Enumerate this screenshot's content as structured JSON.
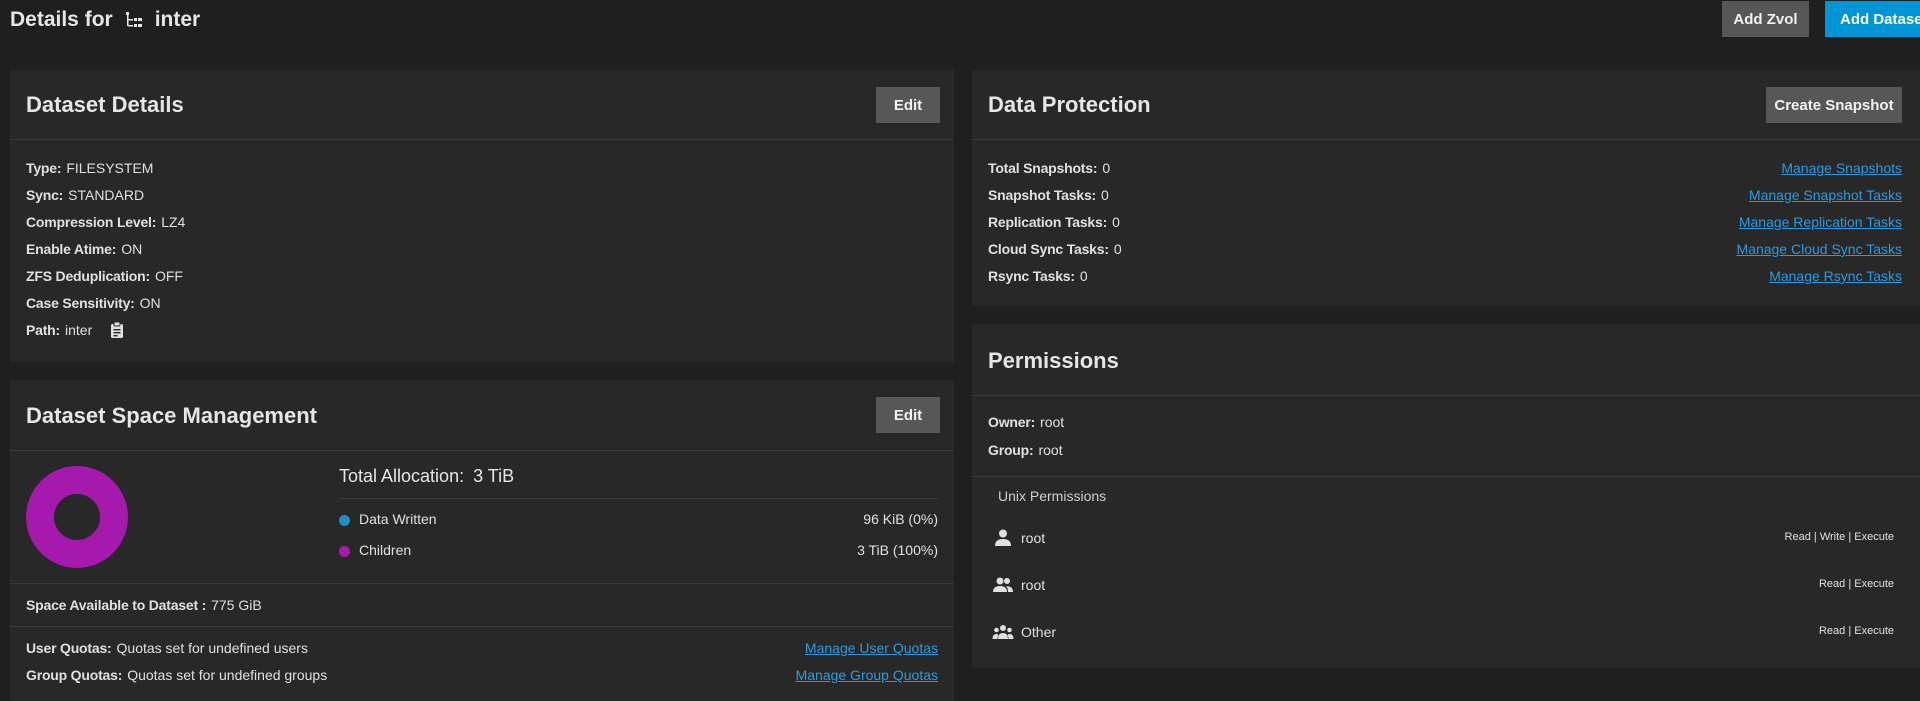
{
  "header": {
    "title_prefix": "Details for",
    "dataset_name": "inter",
    "add_zvol": "Add Zvol",
    "add_dataset": "Add Dataset"
  },
  "dataset_details": {
    "title": "Dataset Details",
    "edit": "Edit",
    "type_label": "Type:",
    "type": "FILESYSTEM",
    "sync_label": "Sync:",
    "sync": "STANDARD",
    "compression_label": "Compression Level:",
    "compression": "LZ4",
    "atime_label": "Enable Atime:",
    "atime": "ON",
    "dedup_label": "ZFS Deduplication:",
    "dedup": "OFF",
    "case_label": "Case Sensitivity:",
    "case": "ON",
    "path_label": "Path:",
    "path": "inter"
  },
  "space": {
    "title": "Dataset Space Management",
    "edit": "Edit",
    "total_label": "Total Allocation:",
    "total": "3 TiB",
    "data_written_label": "Data Written",
    "data_written": "96 KiB (0%)",
    "children_label": "Children",
    "children": "3 TiB (100%)",
    "available_label": "Space Available to Dataset :",
    "available": "775 GiB",
    "user_quotas_label": "User Quotas:",
    "user_quotas": "Quotas set for undefined users",
    "manage_user_quotas": "Manage User Quotas",
    "group_quotas_label": "Group Quotas:",
    "group_quotas": "Quotas set for undefined groups",
    "manage_group_quotas": "Manage Group Quotas",
    "donut": {
      "data_written_fraction": 0.0,
      "children_fraction": 1.0
    },
    "colors": {
      "data_written": "#1a8fcf",
      "children": "#a51aad"
    }
  },
  "protection": {
    "title": "Data Protection",
    "create_snapshot": "Create Snapshot",
    "total_snapshots_label": "Total Snapshots:",
    "total_snapshots": "0",
    "snapshot_tasks_label": "Snapshot Tasks:",
    "snapshot_tasks": "0",
    "replication_tasks_label": "Replication Tasks:",
    "replication_tasks": "0",
    "cloud_sync_tasks_label": "Cloud Sync Tasks:",
    "cloud_sync_tasks": "0",
    "rsync_tasks_label": "Rsync Tasks:",
    "rsync_tasks": "0",
    "manage_snapshots": "Manage Snapshots",
    "manage_snapshot_tasks": "Manage Snapshot Tasks",
    "manage_replication_tasks": "Manage Replication Tasks",
    "manage_cloud_sync_tasks": "Manage Cloud Sync Tasks",
    "manage_rsync_tasks": "Manage Rsync Tasks"
  },
  "permissions": {
    "title": "Permissions",
    "owner_label": "Owner:",
    "owner": "root",
    "group_label": "Group:",
    "group": "root",
    "unix_heading": "Unix Permissions",
    "rows": [
      {
        "icon": "person-icon",
        "name": "root",
        "perms": "Read | Write | Execute"
      },
      {
        "icon": "group-icon",
        "name": "root",
        "perms": "Read | Execute"
      },
      {
        "icon": "people-icon",
        "name": "Other",
        "perms": "Read | Execute"
      }
    ]
  }
}
